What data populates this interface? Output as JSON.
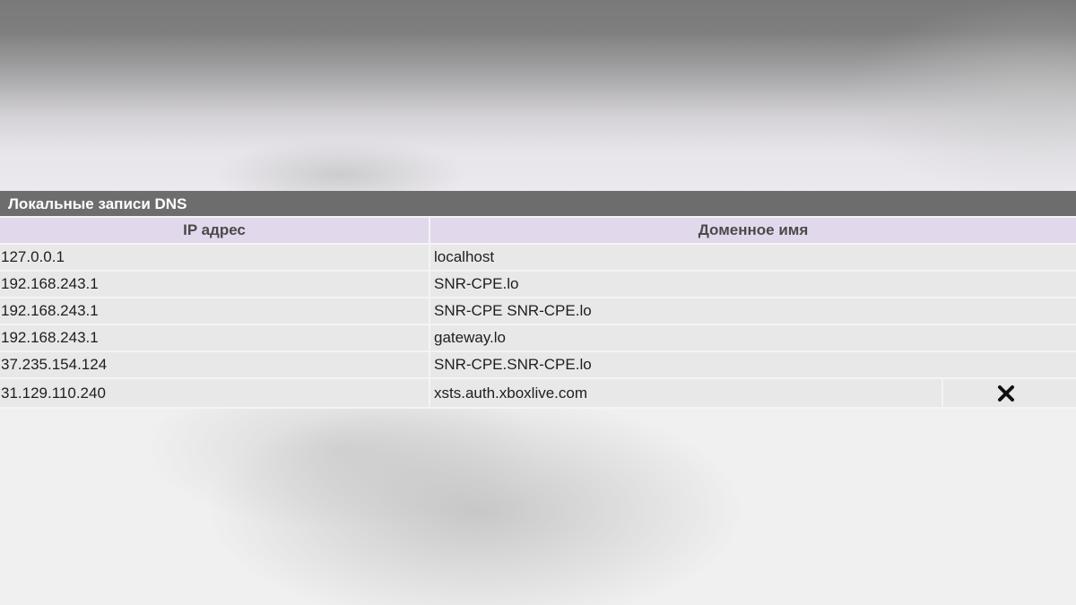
{
  "section": {
    "title": "Локальные записи DNS"
  },
  "table": {
    "headers": {
      "ip": "IP адрес",
      "domain": "Доменное имя"
    },
    "rows": [
      {
        "ip": "127.0.0.1",
        "domain": "localhost"
      },
      {
        "ip": "192.168.243.1",
        "domain": "SNR-CPE.lo"
      },
      {
        "ip": "192.168.243.1",
        "domain": "SNR-CPE SNR-CPE.lo"
      },
      {
        "ip": "192.168.243.1",
        "domain": "gateway.lo"
      },
      {
        "ip": "37.235.154.124",
        "domain": "SNR-CPE.SNR-CPE.lo"
      },
      {
        "ip": "31.129.110.240",
        "domain": "xsts.auth.xboxlive.com",
        "action_icon": "delete-icon"
      }
    ]
  },
  "colors": {
    "section_header_bg": "#6d6d6d",
    "column_header_bg": "#e2d8ec",
    "row_bg": "#e8e8e8"
  }
}
